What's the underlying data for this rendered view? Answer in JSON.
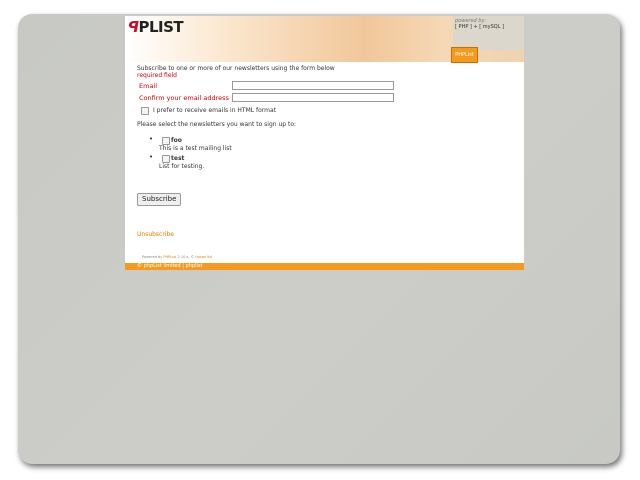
{
  "header": {
    "logo_prefix": "ꟼ",
    "logo_ph": "ꟼ",
    "logo_list": "PLIST",
    "powered_by": "powered by:",
    "stack": "[ PHP ] + [ mySQL ]",
    "tab_label": "PHPList"
  },
  "form": {
    "intro": "Subscribe to one or more of our newsletters using the form below",
    "required": "required field",
    "email_label": "Email",
    "confirm_label": "Confirm your email address",
    "email_value": "",
    "confirm_value": "",
    "html_pref_label": "I prefer to receive emails in HTML format",
    "select_prompt": "Please select the newsletters you want to sign up to:",
    "lists": [
      {
        "name": "foo",
        "description": "This is a test mailing list"
      },
      {
        "name": "test",
        "description": "List for testing."
      }
    ],
    "submit_label": "Subscribe"
  },
  "links": {
    "unsubscribe": "Unsubscribe"
  },
  "powered_line": {
    "prefix": "Powered by",
    "product": "PHPList",
    "version": "2.10.x",
    "sep": ", ©",
    "company": "tincan ltd"
  },
  "footer": {
    "text": "© phpList limited | phplist"
  },
  "colors": {
    "accent": "#f59a1e",
    "required": "#cc0000",
    "backdrop": "#c8c9c4"
  }
}
